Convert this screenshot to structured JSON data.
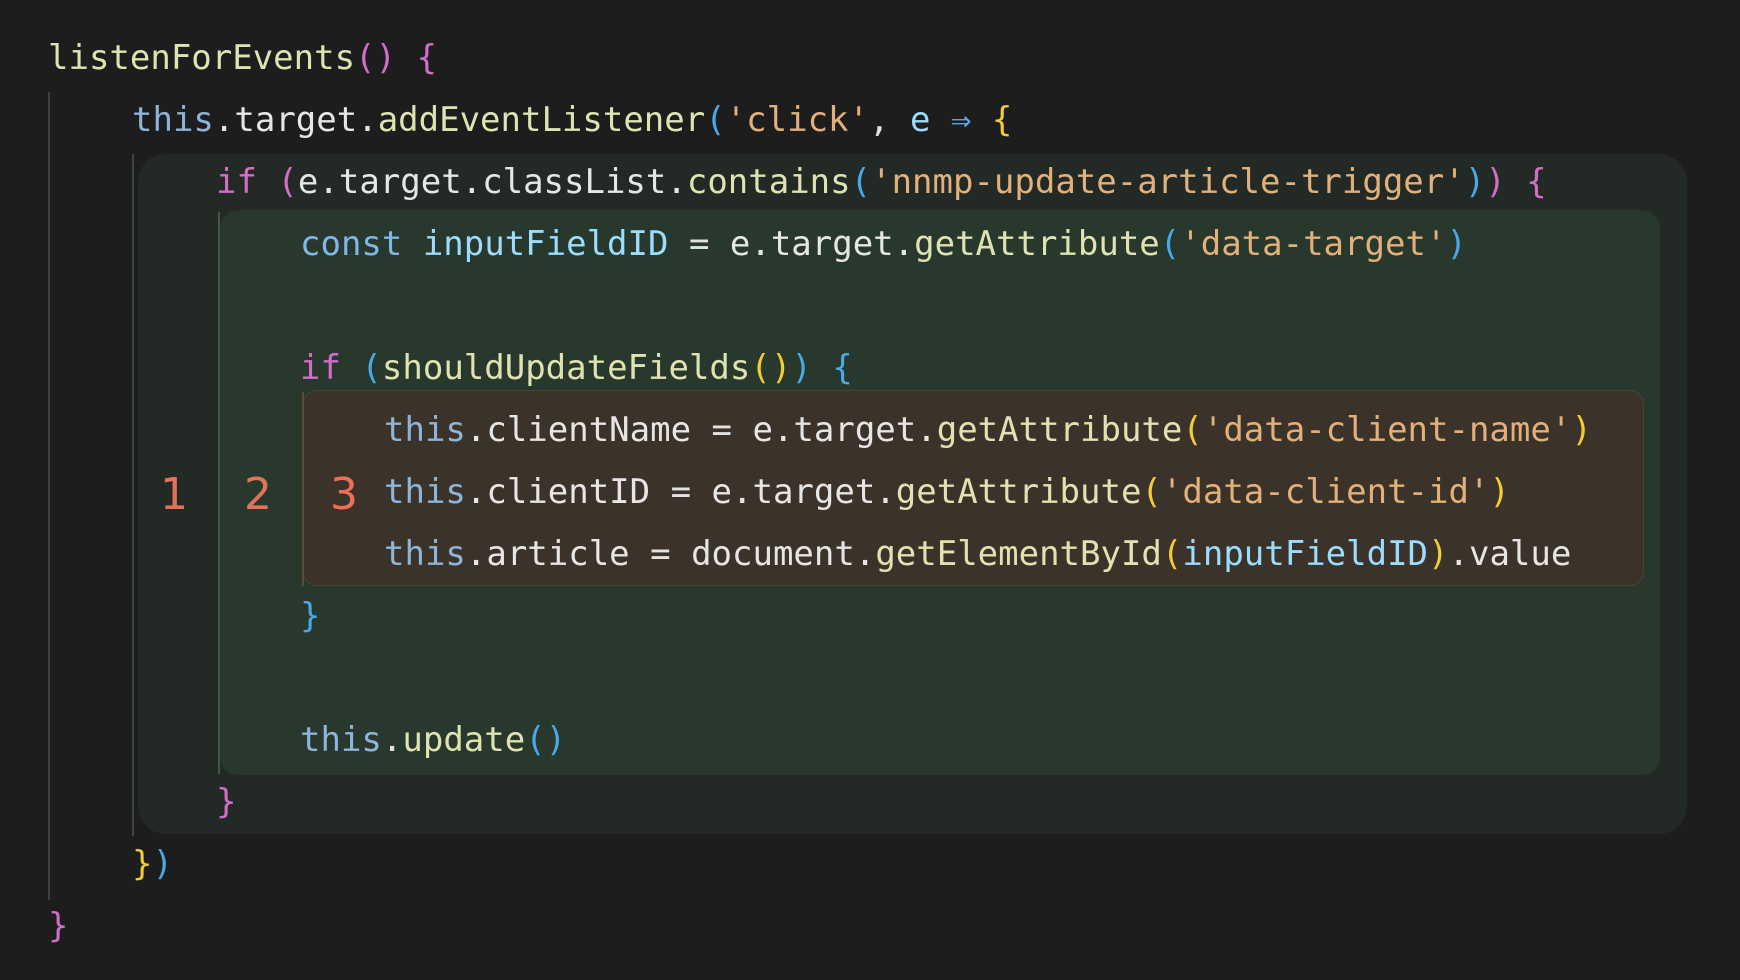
{
  "code": {
    "line1": {
      "fn": "listenForEvents",
      "parens": "()",
      "brace": " {"
    },
    "line2": {
      "this": "this",
      "dot1": ".",
      "target": "target",
      "dot2": ".",
      "fn": "addEventListener",
      "lparen": "(",
      "str": "'click'",
      "comma": ", ",
      "param": "e",
      "arrow": " ⇒ ",
      "brace": "{"
    },
    "line3": {
      "kw": "if",
      "lparen": " (",
      "obj": "e.target.classList.",
      "fn": "contains",
      "lp2": "(",
      "str": "'nnmp-update-article-trigger'",
      "rp2": ")",
      "rparen": ")",
      "brace": " {"
    },
    "line4": {
      "kw": "const",
      "var": " inputFieldID",
      "eq": " = ",
      "obj": "e.target.",
      "fn": "getAttribute",
      "lp": "(",
      "str": "'data-target'",
      "rp": ")"
    },
    "line5": {
      "kw": "if",
      "lparen": " (",
      "fn": "shouldUpdateFields",
      "inner": "()",
      "rparen": ")",
      "brace": " {"
    },
    "line6": {
      "this": "this",
      "prop": ".clientName",
      "eq": " = ",
      "obj": "e.target.",
      "fn": "getAttribute",
      "lp": "(",
      "str": "'data-client-name'",
      "rp": ")"
    },
    "line7": {
      "this": "this",
      "prop": ".clientID",
      "eq": " = ",
      "obj": "e.target.",
      "fn": "getAttribute",
      "lp": "(",
      "str": "'data-client-id'",
      "rp": ")"
    },
    "line8": {
      "this": "this",
      "prop": ".article",
      "eq": " = ",
      "obj": "document.",
      "fn": "getElementById",
      "lp": "(",
      "var": "inputFieldID",
      "rp": ")",
      "tail": ".value"
    },
    "line9": {
      "brace": "}"
    },
    "line10": {
      "this": "this",
      "dot": ".",
      "fn": "update",
      "parens": "()"
    },
    "line11": {
      "brace": "}"
    },
    "line12": {
      "brace": "}",
      "paren": ")"
    },
    "line13": {
      "brace": "}"
    }
  },
  "levels": {
    "one": "1",
    "two": "2",
    "three": "3"
  }
}
